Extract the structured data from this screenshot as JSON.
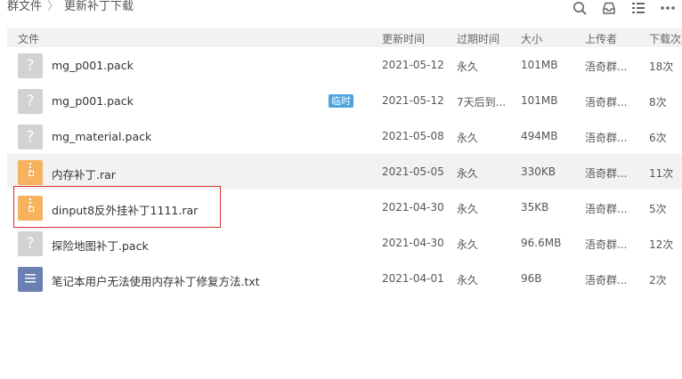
{
  "breadcrumb": {
    "root": "群文件",
    "separator": "〉",
    "current": "更新补丁下载"
  },
  "toolbar": {
    "icons": [
      "search-icon",
      "inbox-icon",
      "list-view-icon",
      "more-icon"
    ]
  },
  "columns": {
    "name": "文件",
    "updated": "更新时间",
    "expires": "过期时间",
    "size": "大小",
    "uploader": "上传者",
    "downloads": "下载次"
  },
  "files": [
    {
      "name": "mg_p001.pack",
      "icon": "unknown-file-icon",
      "badge": "",
      "updated": "2021-05-12",
      "expires": "永久",
      "size": "101MB",
      "uploader": "浯奇群...",
      "downloads": "18次"
    },
    {
      "name": "mg_p001.pack",
      "icon": "unknown-file-icon",
      "badge": "临时",
      "updated": "2021-05-12",
      "expires": "7天后到...",
      "size": "101MB",
      "uploader": "浯奇群...",
      "downloads": "8次"
    },
    {
      "name": "mg_material.pack",
      "icon": "unknown-file-icon",
      "badge": "",
      "updated": "2021-05-08",
      "expires": "永久",
      "size": "494MB",
      "uploader": "浯奇群...",
      "downloads": "6次"
    },
    {
      "name": "内存补丁.rar",
      "icon": "archive-icon",
      "badge": "",
      "updated": "2021-05-05",
      "expires": "永久",
      "size": "330KB",
      "uploader": "浯奇群...",
      "downloads": "11次"
    },
    {
      "name": "dinput8反外挂补丁1111.rar",
      "icon": "archive-icon",
      "badge": "",
      "updated": "2021-04-30",
      "expires": "永久",
      "size": "35KB",
      "uploader": "浯奇群...",
      "downloads": "5次"
    },
    {
      "name": "探险地图补丁.pack",
      "icon": "unknown-file-icon",
      "badge": "",
      "updated": "2021-04-30",
      "expires": "永久",
      "size": "96.6MB",
      "uploader": "浯奇群...",
      "downloads": "12次"
    },
    {
      "name": "笔记本用户无法使用内存补丁修复方法.txt",
      "icon": "text-file-icon",
      "badge": "",
      "updated": "2021-04-01",
      "expires": "永久",
      "size": "96B",
      "uploader": "浯奇群...",
      "downloads": "2次"
    }
  ],
  "colors": {
    "selection_border": "#d9322e",
    "archive_icon": "#f7b260",
    "unknown_icon": "#d2d2d2",
    "text_icon": "#6b7fb2",
    "badge": "#4aa3df",
    "header_bg": "#f2f2f2"
  }
}
